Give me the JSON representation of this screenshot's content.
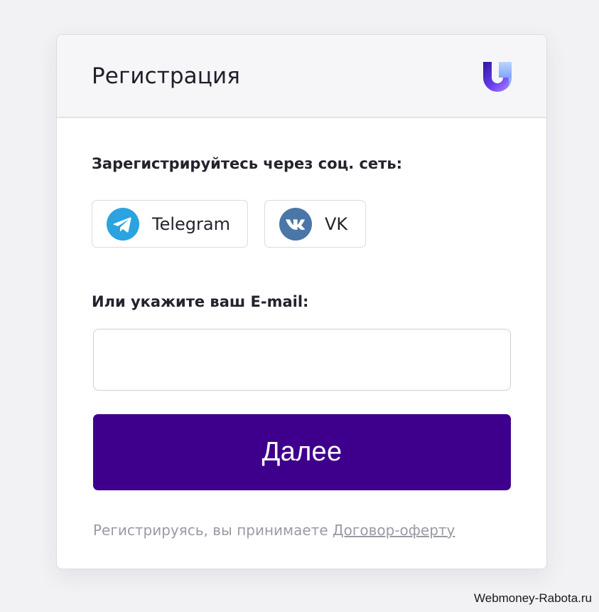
{
  "header": {
    "title": "Регистрация",
    "logo_icon": "u-logo-icon",
    "logo_colors": [
      "#3a1aa8",
      "#6c3ff0",
      "#a9c8ff"
    ]
  },
  "social": {
    "heading": "Зарегистрируйтесь через соц. сеть:",
    "buttons": [
      {
        "label": "Telegram",
        "icon": "telegram-icon",
        "color": "#2aa3e0"
      },
      {
        "label": "VK",
        "icon": "vk-icon",
        "color": "#4a76a8"
      }
    ]
  },
  "email": {
    "heading": "Или укажите ваш E-mail:",
    "value": "",
    "placeholder": ""
  },
  "submit": {
    "label": "Далее",
    "color": "#3e008c"
  },
  "terms": {
    "prefix": "Регистрируясь, вы принимаете ",
    "link": "Договор-оферту"
  },
  "watermark": "Webmoney-Rabota.ru"
}
